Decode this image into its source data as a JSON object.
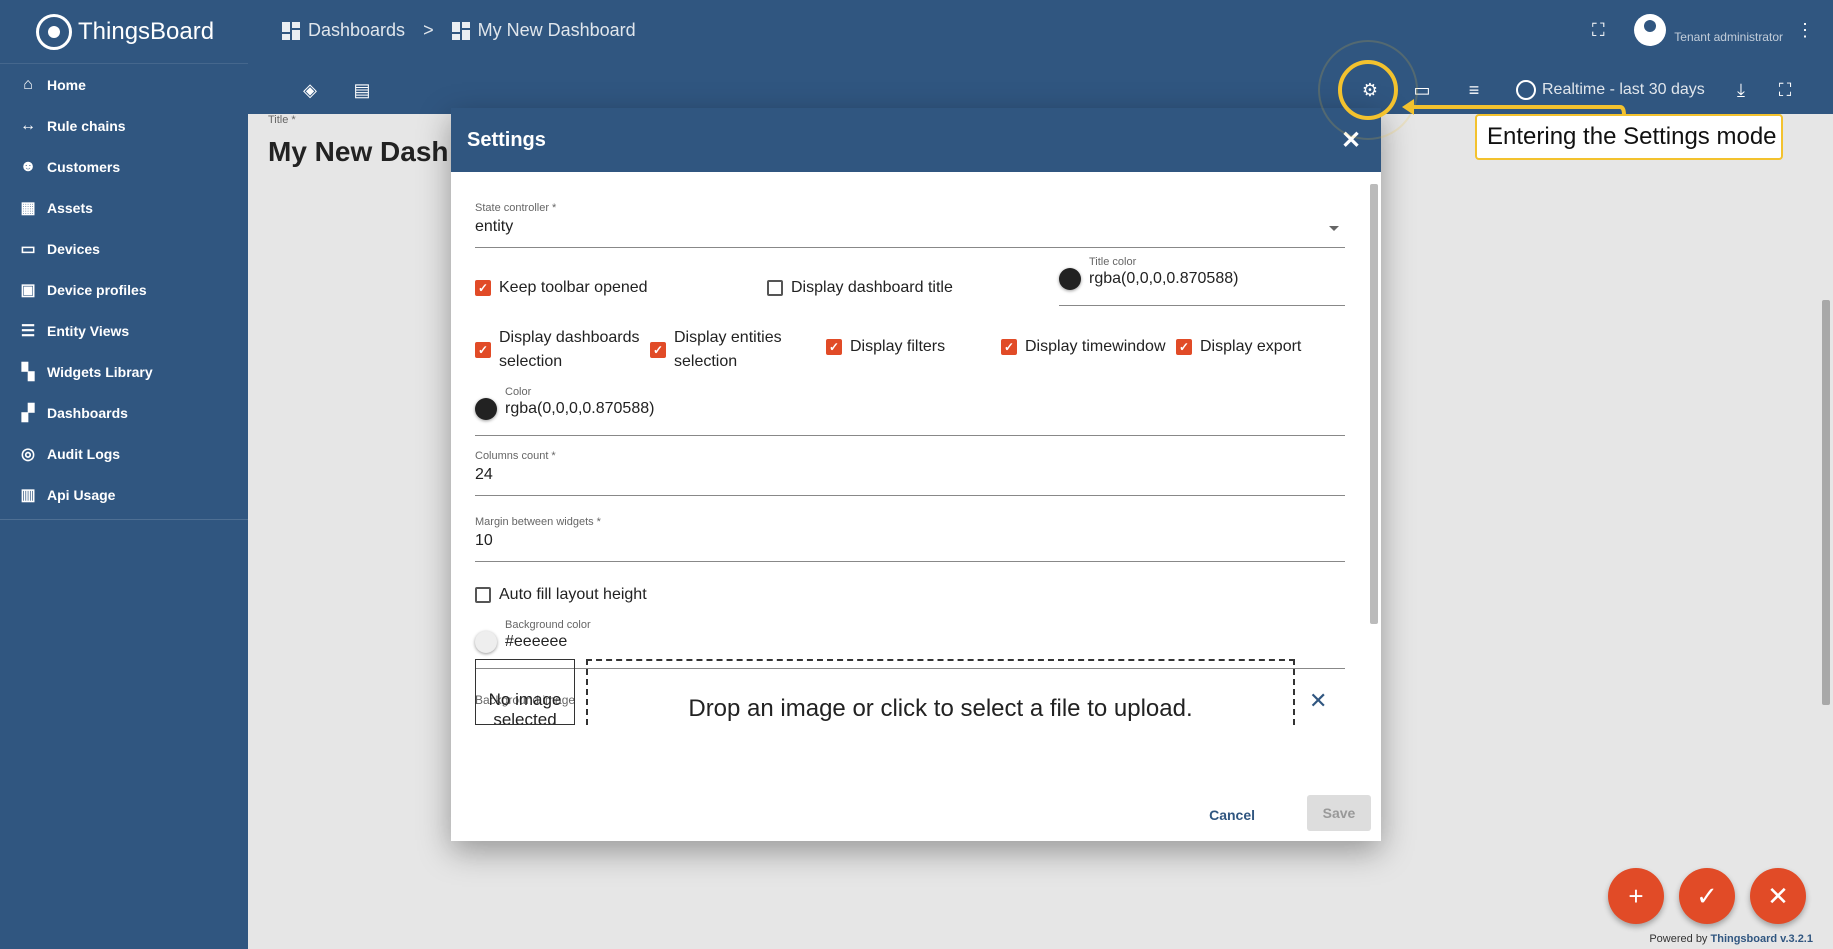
{
  "app": {
    "name": "ThingsBoard"
  },
  "sidebar": {
    "items": [
      {
        "label": "Home",
        "icon": "home-icon"
      },
      {
        "label": "Rule chains",
        "icon": "rule-chain-icon"
      },
      {
        "label": "Customers",
        "icon": "customers-icon"
      },
      {
        "label": "Assets",
        "icon": "assets-icon"
      },
      {
        "label": "Devices",
        "icon": "devices-icon"
      },
      {
        "label": "Device profiles",
        "icon": "device-profile-icon"
      },
      {
        "label": "Entity Views",
        "icon": "entity-views-icon"
      },
      {
        "label": "Widgets Library",
        "icon": "widgets-icon"
      },
      {
        "label": "Dashboards",
        "icon": "dashboards-icon"
      },
      {
        "label": "Audit Logs",
        "icon": "audit-icon"
      },
      {
        "label": "Api Usage",
        "icon": "api-usage-icon"
      }
    ]
  },
  "header": {
    "breadcrumb": [
      "Dashboards",
      ">",
      "My New Dashboard"
    ],
    "user_role": "Tenant administrator",
    "timewindow": "Realtime - last 30 days"
  },
  "dashboard": {
    "title_label": "Title *",
    "title_value": "My New Dash"
  },
  "dialog": {
    "title": "Settings",
    "state_controller": {
      "label": "State controller *",
      "value": "entity"
    },
    "keep_toolbar": {
      "label": "Keep toolbar opened",
      "checked": true
    },
    "display_title": {
      "label": "Display dashboard title",
      "checked": false
    },
    "title_color": {
      "label": "Title color",
      "value": "rgba(0,0,0,0.870588)",
      "swatch": "#222222"
    },
    "display_dashboards": {
      "label": "Display dashboards selection",
      "checked": true
    },
    "display_entities": {
      "label": "Display entities selection",
      "checked": true
    },
    "display_filters": {
      "label": "Display filters",
      "checked": true
    },
    "display_timewindow": {
      "label": "Display timewindow",
      "checked": true
    },
    "display_export": {
      "label": "Display export",
      "checked": true
    },
    "color": {
      "label": "Color",
      "value": "rgba(0,0,0,0.870588)",
      "swatch": "#222222"
    },
    "columns_count": {
      "label": "Columns count *",
      "value": "24"
    },
    "margin": {
      "label": "Margin between widgets *",
      "value": "10"
    },
    "auto_fill": {
      "label": "Auto fill layout height",
      "checked": false
    },
    "background_color": {
      "label": "Background color",
      "value": "#eeeeee",
      "swatch": "#eeeeee"
    },
    "background_image": {
      "label": "Background image",
      "no_image": "No image selected",
      "drop_text": "Drop an image or click to select a file to upload."
    },
    "cancel": "Cancel",
    "save": "Save"
  },
  "footer": {
    "powered_prefix": "Powered by",
    "powered_link": "Thingsboard v.3.2.1"
  },
  "callout": {
    "text": "Entering the Settings mode"
  },
  "colors": {
    "primary": "#305680",
    "accent": "#e14b27",
    "highlight": "#f3c22e"
  }
}
